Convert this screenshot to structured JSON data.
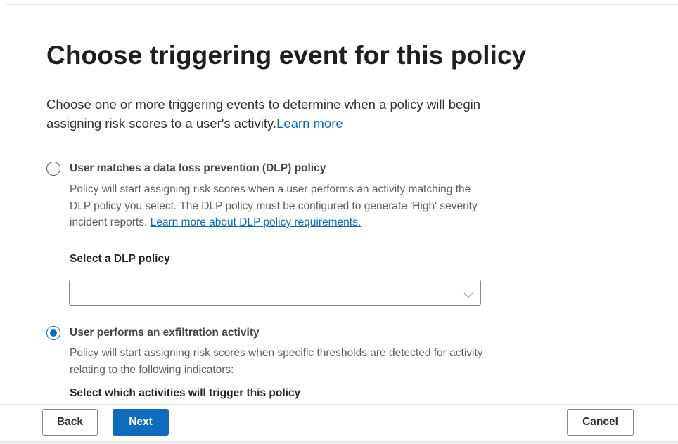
{
  "page": {
    "title": "Choose triggering event for this policy",
    "description": "Choose one or more triggering events to determine when a policy will begin assigning risk scores to a user's activity.",
    "learn_more": "Learn more"
  },
  "options": [
    {
      "label": "User matches a data loss prevention (DLP) policy",
      "selected": false,
      "description": "Policy will start assigning risk scores when a user performs an activity matching the DLP policy you select. The DLP policy must be configured to generate 'High' severity incident reports.",
      "link": "Learn more about DLP policy requirements.",
      "field_label": "Select a DLP policy",
      "dropdown_value": ""
    },
    {
      "label": "User performs an exfiltration activity",
      "selected": true,
      "description": "Policy will start assigning risk scores when specific thresholds are detected for activity relating to the following indicators:",
      "field_label": "Select which activities will trigger this policy"
    }
  ],
  "footer": {
    "back_label": "Back",
    "next_label": "Next",
    "cancel_label": "Cancel"
  },
  "colors": {
    "accent": "#0f6cbd",
    "text": "#323130",
    "muted_text": "#605e5c",
    "border": "#8a8886"
  },
  "icons": {
    "dropdown": "chevron-down-icon"
  }
}
